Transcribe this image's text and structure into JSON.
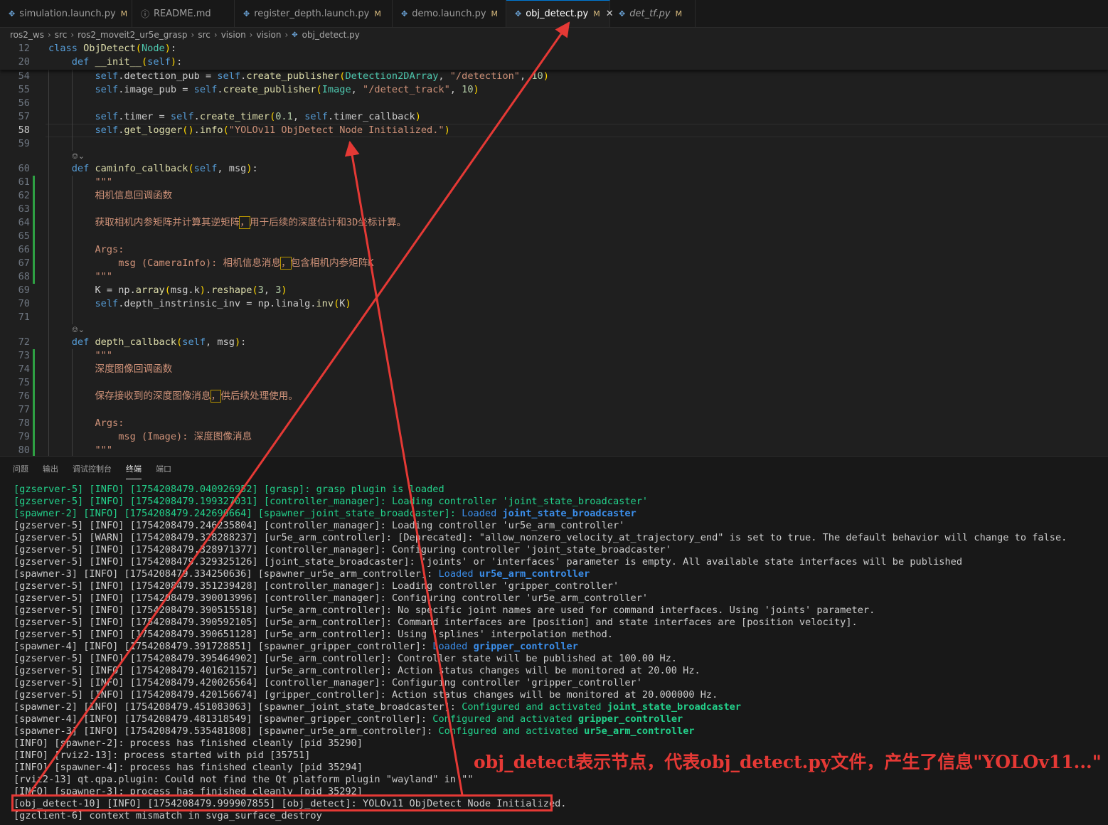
{
  "tabs": [
    {
      "label": "simulation.launch.py",
      "status": "M",
      "icon": "python-file-icon",
      "active": false,
      "italic": false
    },
    {
      "label": "README.md",
      "status": "",
      "icon": "info-icon",
      "active": false,
      "italic": false
    },
    {
      "label": "register_depth.launch.py",
      "status": "M",
      "icon": "python-file-icon",
      "active": false,
      "italic": false
    },
    {
      "label": "demo.launch.py",
      "status": "M",
      "icon": "python-file-icon",
      "active": false,
      "italic": false
    },
    {
      "label": "obj_detect.py",
      "status": "M",
      "icon": "python-file-icon",
      "active": true,
      "italic": false
    },
    {
      "label": "det_tf.py",
      "status": "M",
      "icon": "python-file-icon",
      "active": false,
      "italic": true
    }
  ],
  "breadcrumb": [
    "ros2_ws",
    "src",
    "ros2_moveit2_ur5e_grasp",
    "src",
    "vision",
    "vision",
    "obj_detect.py"
  ],
  "editor": {
    "sticky": [
      {
        "num": "12",
        "code": "class ObjDetect(Node):"
      },
      {
        "num": "20",
        "code": "    def __init__(self):"
      }
    ],
    "lines": [
      {
        "num": "54",
        "code": "        self.detection_pub = self.create_publisher(Detection2DArray, \"/detection\", 10)"
      },
      {
        "num": "55",
        "code": "        self.image_pub = self.create_publisher(Image, \"/detect_track\", 10)"
      },
      {
        "num": "56",
        "code": ""
      },
      {
        "num": "57",
        "code": "        self.timer = self.create_timer(0.1, self.timer_callback)"
      },
      {
        "num": "58",
        "code": "        self.get_logger().info(\"YOLOv11 ObjDetect Node Initialized.\")"
      },
      {
        "num": "59",
        "code": ""
      },
      {
        "num": "",
        "code": "",
        "lens": "⎊⌄"
      },
      {
        "num": "60",
        "code": "    def caminfo_callback(self, msg):"
      },
      {
        "num": "61",
        "code": "        \"\"\""
      },
      {
        "num": "62",
        "code": "        相机信息回调函数"
      },
      {
        "num": "63",
        "code": ""
      },
      {
        "num": "64",
        "code": "        获取相机内参矩阵并计算其逆矩阵，用于后续的深度估计和3D坐标计算。"
      },
      {
        "num": "65",
        "code": ""
      },
      {
        "num": "66",
        "code": "        Args:"
      },
      {
        "num": "67",
        "code": "            msg (CameraInfo): 相机信息消息，包含相机内参矩阵K"
      },
      {
        "num": "68",
        "code": "        \"\"\""
      },
      {
        "num": "69",
        "code": "        K = np.array(msg.k).reshape(3, 3)"
      },
      {
        "num": "70",
        "code": "        self.depth_instrinsic_inv = np.linalg.inv(K)"
      },
      {
        "num": "71",
        "code": ""
      },
      {
        "num": "",
        "code": "",
        "lens": "⎊⌄"
      },
      {
        "num": "72",
        "code": "    def depth_callback(self, msg):"
      },
      {
        "num": "73",
        "code": "        \"\"\""
      },
      {
        "num": "74",
        "code": "        深度图像回调函数"
      },
      {
        "num": "75",
        "code": ""
      },
      {
        "num": "76",
        "code": "        保存接收到的深度图像消息，供后续处理使用。"
      },
      {
        "num": "77",
        "code": ""
      },
      {
        "num": "78",
        "code": "        Args:"
      },
      {
        "num": "79",
        "code": "            msg (Image): 深度图像消息"
      },
      {
        "num": "80",
        "code": "        \"\"\""
      }
    ]
  },
  "panel": {
    "tabs": [
      "问题",
      "输出",
      "调试控制台",
      "终端",
      "端口"
    ],
    "active_tab": "终端"
  },
  "terminal": [
    {
      "text": "[gzserver-5] [INFO] [1754208479.040926952] [grasp]: grasp plugin is loaded",
      "color": "green"
    },
    {
      "text": "[gzserver-5] [INFO] [1754208479.199327031] [controller_manager]: Loading controller 'joint_state_broadcaster'",
      "color": "green"
    },
    {
      "text": "[spawner-2] [INFO] [1754208479.242690664] [spawner_joint_state_broadcaster]: ",
      "color": "green",
      "suffix": "Loaded ",
      "suffix_bold": "joint_state_broadcaster",
      "suffix_color": "blue"
    },
    {
      "text": "[gzserver-5] [INFO] [1754208479.246235804] [controller_manager]: Loading controller 'ur5e_arm_controller'",
      "color": "white"
    },
    {
      "text": "[gzserver-5] [WARN] [1754208479.328288237] [ur5e_arm_controller]: [Deprecated]: \"allow_nonzero_velocity_at_trajectory_end\" is set to true. The default behavior will change to false.",
      "color": "white"
    },
    {
      "text": "[gzserver-5] [INFO] [1754208479.328971377] [controller_manager]: Configuring controller 'joint_state_broadcaster'",
      "color": "white"
    },
    {
      "text": "[gzserver-5] [INFO] [1754208479.329325126] [joint_state_broadcaster]: 'joints' or 'interfaces' parameter is empty. All available state interfaces will be published",
      "color": "white"
    },
    {
      "text": "[spawner-3] [INFO] [1754208479.334250636] [spawner_ur5e_arm_controller]: ",
      "color": "white",
      "suffix": "Loaded ",
      "suffix_bold": "ur5e_arm_controller",
      "suffix_color": "blue"
    },
    {
      "text": "[gzserver-5] [INFO] [1754208479.351239428] [controller_manager]: Loading controller 'gripper_controller'",
      "color": "white"
    },
    {
      "text": "[gzserver-5] [INFO] [1754208479.390013996] [controller_manager]: Configuring controller 'ur5e_arm_controller'",
      "color": "white"
    },
    {
      "text": "[gzserver-5] [INFO] [1754208479.390515518] [ur5e_arm_controller]: No specific joint names are used for command interfaces. Using 'joints' parameter.",
      "color": "white"
    },
    {
      "text": "[gzserver-5] [INFO] [1754208479.390592105] [ur5e_arm_controller]: Command interfaces are [position] and state interfaces are [position velocity].",
      "color": "white"
    },
    {
      "text": "[gzserver-5] [INFO] [1754208479.390651128] [ur5e_arm_controller]: Using 'splines' interpolation method.",
      "color": "white"
    },
    {
      "text": "[spawner-4] [INFO] [1754208479.391728851] [spawner_gripper_controller]: ",
      "color": "white",
      "suffix": "Loaded ",
      "suffix_bold": "gripper_controller",
      "suffix_color": "blue"
    },
    {
      "text": "[gzserver-5] [INFO] [1754208479.395464902] [ur5e_arm_controller]: Controller state will be published at 100.00 Hz.",
      "color": "white"
    },
    {
      "text": "[gzserver-5] [INFO] [1754208479.401621157] [ur5e_arm_controller]: Action status changes will be monitored at 20.00 Hz.",
      "color": "white"
    },
    {
      "text": "[gzserver-5] [INFO] [1754208479.420026564] [controller_manager]: Configuring controller 'gripper_controller'",
      "color": "white"
    },
    {
      "text": "[gzserver-5] [INFO] [1754208479.420156674] [gripper_controller]: Action status changes will be monitored at 20.000000 Hz.",
      "color": "white"
    },
    {
      "text": "[spawner-2] [INFO] [1754208479.451083063] [spawner_joint_state_broadcaster]: ",
      "color": "white",
      "suffix": "Configured and activated ",
      "suffix_bold": "joint_state_broadcaster",
      "suffix_color": "green"
    },
    {
      "text": "[spawner-4] [INFO] [1754208479.481318549] [spawner_gripper_controller]: ",
      "color": "white",
      "suffix": "Configured and activated ",
      "suffix_bold": "gripper_controller",
      "suffix_color": "green"
    },
    {
      "text": "[spawner-3] [INFO] [1754208479.535481808] [spawner_ur5e_arm_controller]: ",
      "color": "white",
      "suffix": "Configured and activated ",
      "suffix_bold": "ur5e_arm_controller",
      "suffix_color": "green"
    },
    {
      "text": "[INFO] [spawner-2]: process has finished cleanly [pid 35290]",
      "color": "white"
    },
    {
      "text": "[INFO] [rviz2-13]: process started with pid [35751]",
      "color": "white"
    },
    {
      "text": "[INFO] [spawner-4]: process has finished cleanly [pid 35294]",
      "color": "white"
    },
    {
      "text": "[rviz2-13] qt.qpa.plugin: Could not find the Qt platform plugin \"wayland\" in \"\"",
      "color": "white"
    },
    {
      "text": "[INFO] [spawner-3]: process has finished cleanly [pid 35292]",
      "color": "white"
    },
    {
      "text": "[obj_detect-10] [INFO] [1754208479.999907855] [obj_detect]: YOLOv11 ObjDetect Node Initialized.",
      "color": "white"
    },
    {
      "text": "[gzclient-6] context mismatch in svga_surface_destroy",
      "color": "white"
    }
  ],
  "annotation": {
    "text": "obj_detect表示节点，代表obj_detect.py文件，产生了信息\"YOLOv11...\"",
    "color": "#e53935"
  }
}
